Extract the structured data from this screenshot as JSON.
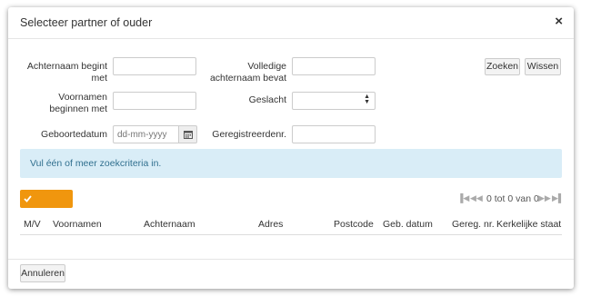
{
  "dialog": {
    "title": "Selecteer partner of ouder",
    "close_symbol": "×"
  },
  "form": {
    "lastname_starts_label": "Achternaam begint met",
    "full_lastname_contains_label": "Volledige achternaam bevat",
    "firstnames_start_label": "Voornamen beginnen met",
    "gender_label": "Geslacht",
    "birthdate_label": "Geboortedatum",
    "birthdate_placeholder": "dd-mm-yyyy",
    "registered_nr_label": "Geregistreerdenr.",
    "search_button": "Zoeken",
    "clear_button": "Wissen",
    "gender_value": ""
  },
  "alert": {
    "message": "Vul één of meer zoekcriteria in."
  },
  "results": {
    "select_button": "Selecteer",
    "pager_text": "0 tot 0 van 0",
    "columns": [
      "M/V",
      "Voornamen",
      "Achternaam",
      "Adres",
      "Postcode",
      "Geb. datum",
      "Gereg. nr.",
      "Kerkelijke staat"
    ],
    "rows": []
  },
  "footer": {
    "cancel_button": "Annuleren"
  },
  "icons": {
    "calendar": "calendar-icon",
    "check": "check-icon",
    "first": "first-page-icon",
    "prev": "previous-page-icon",
    "next": "next-page-icon",
    "last": "last-page-icon"
  },
  "colors": {
    "primary_warning": "#f0960e",
    "alert_bg": "#d9edf7",
    "alert_text": "#31708f"
  }
}
